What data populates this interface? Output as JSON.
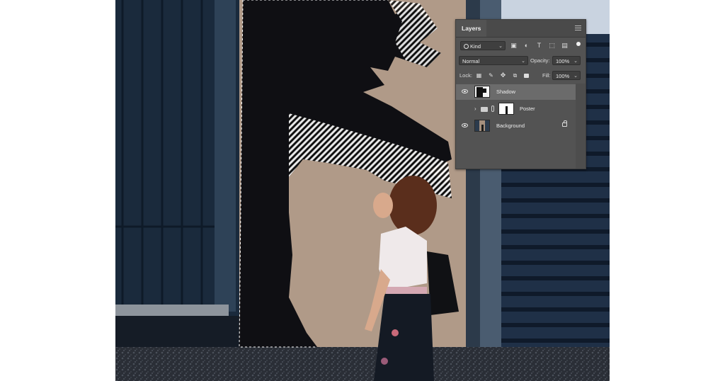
{
  "panel": {
    "tab_label": "Layers",
    "filter": {
      "label": "Kind"
    },
    "blend_mode": "Normal",
    "opacity_label": "Opacity:",
    "opacity_value": "100%",
    "lock_label": "Lock:",
    "fill_label": "Fill:",
    "fill_value": "100%",
    "layers": [
      {
        "name": "Shadow",
        "visible": true,
        "selected": true
      },
      {
        "name": "Poster",
        "visible": false,
        "is_group": true
      },
      {
        "name": "Background",
        "visible": true,
        "locked": true
      }
    ]
  },
  "colors": {
    "panel_bg": "#535353",
    "selected_row": "#6b6b6b",
    "wall": "#b09a88",
    "shadow_selection": "#0f0f13",
    "shutter": "#1e2f44"
  },
  "icons": [
    "search-icon",
    "image-filter-icon",
    "adjustment-filter-icon",
    "type-filter-icon",
    "shape-filter-icon",
    "smart-object-filter-icon",
    "eye-icon",
    "folder-icon",
    "link-icon",
    "lock-icon",
    "chevron-right-icon",
    "panel-menu-icon"
  ]
}
